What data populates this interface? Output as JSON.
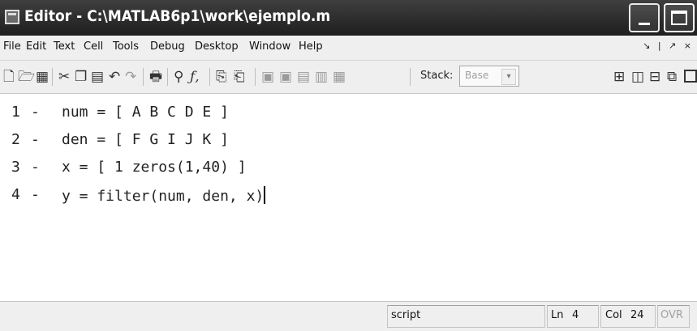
{
  "window": {
    "title": "Editor - C:\\MATLAB6p1\\work\\ejemplo.m"
  },
  "menu": {
    "items": [
      "File",
      "Edit",
      "Text",
      "Cell",
      "Tools",
      "Debug",
      "Desktop",
      "Window",
      "Help"
    ],
    "dock_controls": "↘ | ↗ ×"
  },
  "toolbar": {
    "stack_label": "Stack:",
    "stack_value": "Base",
    "icons": [
      "new-file-icon",
      "open-file-icon",
      "save-icon",
      "cut-icon",
      "copy-icon",
      "paste-icon",
      "undo-icon",
      "redo-icon",
      "print-icon",
      "find-icon",
      "function-icon",
      "cell-icon-1",
      "cell-icon-2",
      "breakpoint-set-icon",
      "breakpoint-clear-icon",
      "step-icon",
      "step-in-icon",
      "step-out-icon",
      "tile-icon",
      "split-vertical-icon",
      "split-horizontal-icon",
      "float-icon",
      "maximize-pane-icon"
    ]
  },
  "editor": {
    "lines": [
      {
        "number": "1",
        "marker": "-",
        "code": "num = [ A B C D E ]"
      },
      {
        "number": "2",
        "marker": "-",
        "code": "den = [ F G I J K ]"
      },
      {
        "number": "3",
        "marker": "-",
        "code": "x = [ 1 zeros(1,40) ]"
      },
      {
        "number": "4",
        "marker": "-",
        "code": "y = filter(num, den, x)"
      }
    ]
  },
  "status": {
    "mode": "script",
    "line_label": "Ln",
    "line_value": "4",
    "col_label": "Col",
    "col_value": "24",
    "ovr": "OVR"
  },
  "colors": {
    "titlebar": "#2b2b2b",
    "background": "#efefef",
    "editor": "#ffffff"
  }
}
